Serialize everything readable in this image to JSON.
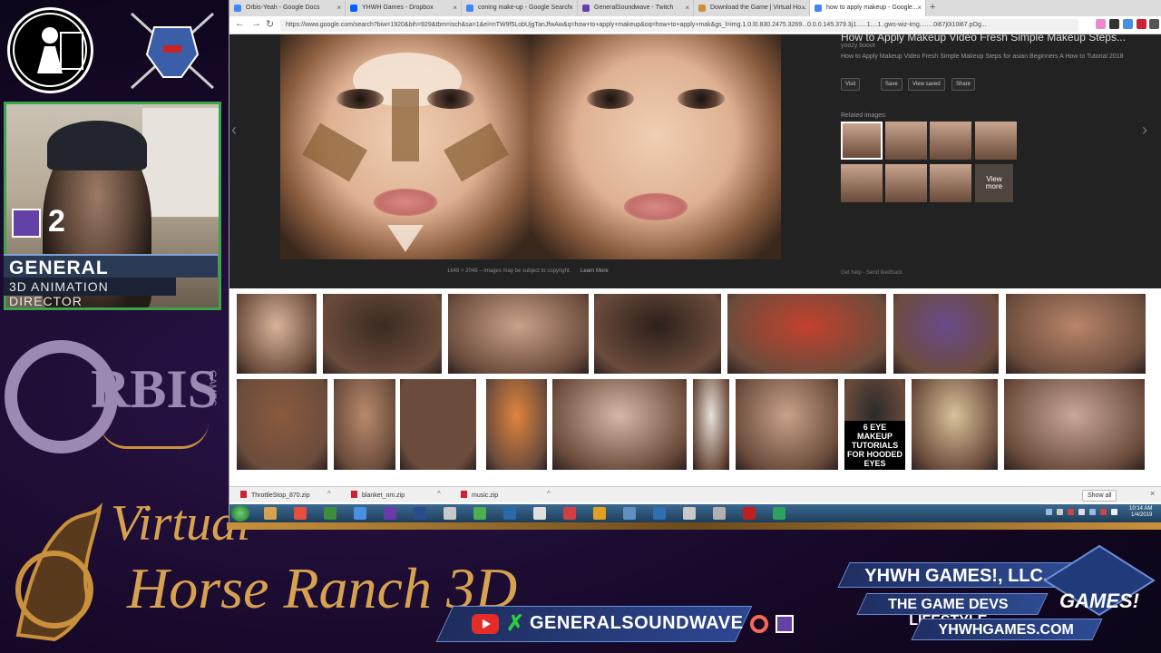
{
  "overlay": {
    "viewer_count": "2",
    "streamer_name": "GENERAL SOUNDWAVE",
    "streamer_role": "3D ANIMATION DIRECTOR",
    "orbis_brand": "RBIS",
    "orbis_games": "GAMES",
    "game_title_line1": "Virtual",
    "game_title_line2": "Horse Ranch 3D",
    "company": "YHWH GAMES!, LLC.",
    "tagline": "THE GAME DEVS LIFESTYLE",
    "website": "YHWHGAMES.COM",
    "social_handle": "GENERALSOUNDWAVE",
    "logo_text": "GAMES!"
  },
  "browser": {
    "tabs": [
      {
        "label": "Orbis-Yeah - Google Docs",
        "color": "#4285f4"
      },
      {
        "label": "YHWH Games - Dropbox",
        "color": "#0061fe"
      },
      {
        "label": "coning make-up - Google Search",
        "color": "#4285f4"
      },
      {
        "label": "GeneralSoundwave - Twitch",
        "color": "#6441a5"
      },
      {
        "label": "Download the Game | Virtual Ho...",
        "color": "#c9913c"
      },
      {
        "label": "how to apply makeup - Google...",
        "color": "#4285f4"
      }
    ],
    "new_tab": "+",
    "url": "https://www.google.com/search?biw=1920&bih=929&tbm=isch&sa=1&ei=nTW9f5LobUjgTanJfwAw&q=how+to+apply+makeup&oq=how+to+apply+mak&gs_l=img.1.0.l0.830.2475.3269...0.0.0.145.379.3j1......1....1..gws-wiz-img........0i67j0i10i67.pOg..."
  },
  "image_viewer": {
    "title": "How to Apply Makeup Video Fresh Simple Makeup Steps...",
    "source": "yoozy booot",
    "description": "How to Apply Makeup Video Fresh Simple Makeup Steps for asian Beginners A How to Tutorial 2018",
    "buttons": [
      "Visit",
      "Save",
      "View saved",
      "Share"
    ],
    "related_label": "Related images:",
    "view_more": "View more",
    "caption": "1648 × 2048 – Images may be subject to copyright.",
    "learn_more": "Learn More",
    "footer": "Get help - Send feedback"
  },
  "grid_thumbs": [
    {
      "color": "#d9b49a"
    },
    {
      "color": "#3b2a22"
    },
    {
      "color": "#caa18a"
    },
    {
      "color": "#2c1f1a"
    },
    {
      "color": "#c4412e"
    },
    {
      "color": "#6a4a8a"
    },
    {
      "color": "#b8856a"
    },
    {
      "color": "#8a5a3e"
    },
    {
      "color": "#b88a6c"
    },
    {
      "color": "#6a4a3a"
    },
    {
      "color": "#e0843c"
    },
    {
      "color": "#d4b8a6"
    },
    {
      "color": "#e8e2dc"
    },
    {
      "color": "#c8a28a"
    },
    {
      "color": "#2a2a2a"
    },
    {
      "color": "#d8c29a"
    },
    {
      "color": "#c9a79a"
    }
  ],
  "thumb_text": "6 EYE MAKEUP TUTORIALS FOR HOODED EYES",
  "downloads": [
    {
      "name": "ThrottleStop_870.zip"
    },
    {
      "name": "blanket_nm.zip"
    },
    {
      "name": "music.zip"
    }
  ],
  "download_show_all": "Show all",
  "taskbar": {
    "time": "10:14 AM",
    "date": "1/4/2019"
  }
}
